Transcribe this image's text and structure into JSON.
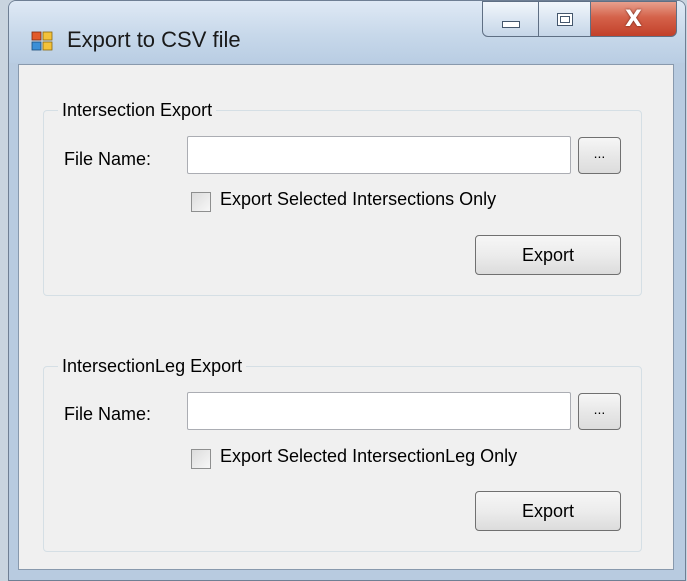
{
  "window": {
    "title": "Export to CSV file",
    "caption_buttons": {
      "minimize_icon": "minimize-icon",
      "maximize_icon": "maximize-icon",
      "close_glyph": "X"
    }
  },
  "groups": [
    {
      "legend": "Intersection Export",
      "file_label": "File Name:",
      "file_value": "",
      "browse_label": "...",
      "checkbox_label": "Export Selected Intersections Only",
      "checkbox_checked": false,
      "export_label": "Export"
    },
    {
      "legend": "IntersectionLeg Export",
      "file_label": "File Name:",
      "file_value": "",
      "browse_label": "...",
      "checkbox_label": "Export Selected IntersectionLeg Only",
      "checkbox_checked": false,
      "export_label": "Export"
    }
  ],
  "colors": {
    "client_bg": "#f0f0f0",
    "title_bar": "#c7d8ea",
    "close_button": "#c2402a"
  }
}
